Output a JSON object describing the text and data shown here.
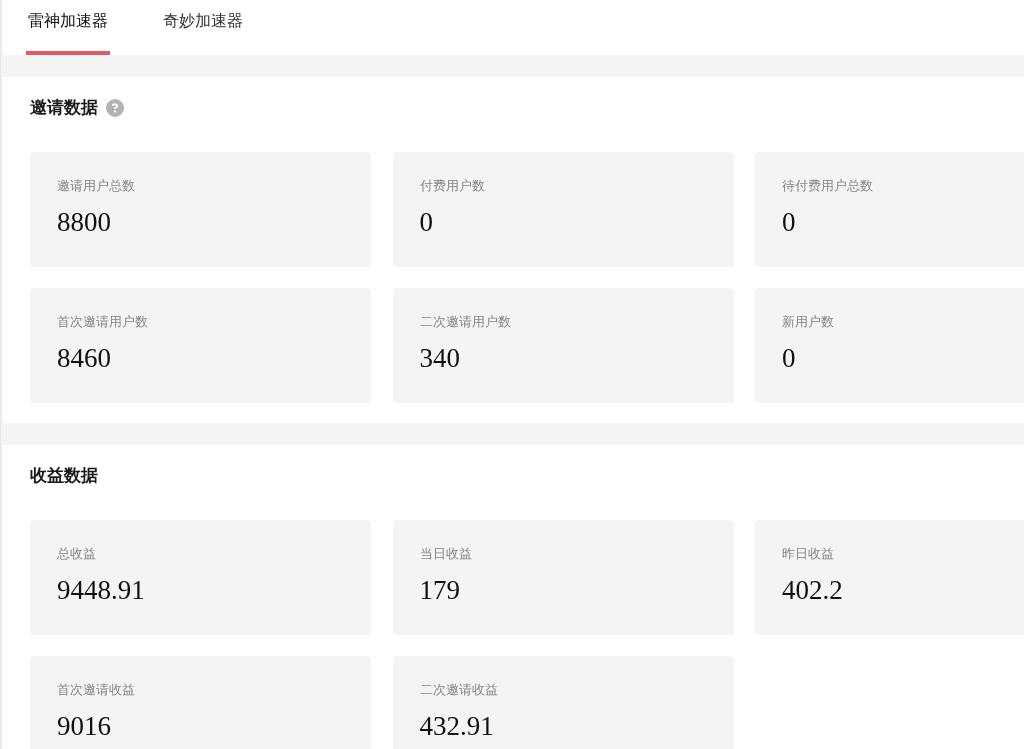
{
  "tabs": [
    {
      "label": "雷神加速器",
      "selected": true
    },
    {
      "label": "奇妙加速器",
      "selected": false
    }
  ],
  "sections": [
    {
      "title": "邀请数据",
      "help": true,
      "stats": [
        {
          "label": "邀请用户总数",
          "value": "8800"
        },
        {
          "label": "付费用户数",
          "value": "0"
        },
        {
          "label": "待付费用户总数",
          "value": "0"
        },
        {
          "label": "首次邀请用户数",
          "value": "8460"
        },
        {
          "label": "二次邀请用户数",
          "value": "340"
        },
        {
          "label": "新用户数",
          "value": "0"
        }
      ]
    },
    {
      "title": "收益数据",
      "help": false,
      "stats": [
        {
          "label": "总收益",
          "value": "9448.91"
        },
        {
          "label": "当日收益",
          "value": "179"
        },
        {
          "label": "昨日收益",
          "value": "402.2"
        },
        {
          "label": "首次邀请收益",
          "value": "9016"
        },
        {
          "label": "二次邀请收益",
          "value": "432.91"
        }
      ]
    }
  ]
}
